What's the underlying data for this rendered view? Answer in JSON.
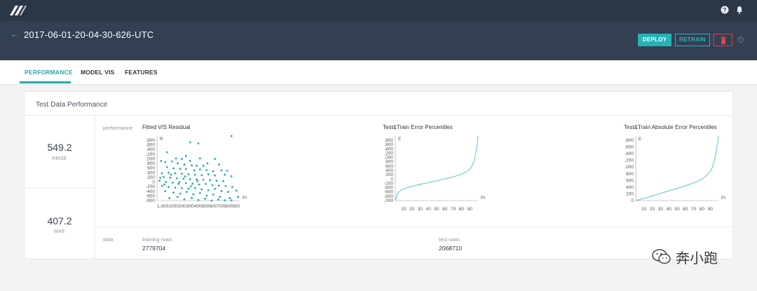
{
  "topbar": {
    "icons": [
      "help-icon",
      "bell-icon"
    ]
  },
  "header": {
    "back_icon": "back-arrow-icon",
    "title": "2017-06-01-20-04-30-626-UTC",
    "buttons": {
      "deploy": "DEPLOY",
      "retrain": "RETRAIN"
    },
    "delete_icon": "trash-icon",
    "settings_icon": "gear-icon"
  },
  "tabs": [
    {
      "label": "PERFORMANCE",
      "active": true
    },
    {
      "label": "MODEL VIS",
      "active": false
    },
    {
      "label": "FEATURES",
      "active": false
    }
  ],
  "card": {
    "title": "Test Data Performance",
    "metrics": [
      {
        "value": "549.2",
        "label": "RMSE"
      },
      {
        "value": "407.2",
        "label": "MAE"
      }
    ],
    "performance_label": "performance",
    "data_label": "data",
    "training_rows_label": "training rows",
    "training_rows_value": "2779704",
    "test_rows_label": "test rows",
    "test_rows_value": "2068710"
  },
  "accent_color": "#2aa6ab",
  "watermark": {
    "text": "奔小跑",
    "icon": "wechat-icon"
  },
  "chart_data": [
    {
      "type": "scatter",
      "title": "Fitted V/S Residual",
      "xlabel": "Pr",
      "ylabel": "R",
      "ytick_labels": [
        ",800",
        ",600",
        ",400",
        ",200",
        ",000",
        "800",
        "600",
        "400",
        "200",
        "0",
        "-200",
        "-400",
        "-600",
        "-800"
      ],
      "xtick_labels": "1,0001000200300400500600700800900",
      "ylim": [
        -800,
        1800
      ],
      "xlim": [
        0,
        1000
      ],
      "points": [
        [
          900,
          1800
        ],
        [
          400,
          1550
        ],
        [
          500,
          1500
        ],
        [
          120,
          1150
        ],
        [
          350,
          1000
        ],
        [
          230,
          900
        ],
        [
          300,
          880
        ],
        [
          400,
          800
        ],
        [
          520,
          900
        ],
        [
          700,
          880
        ],
        [
          50,
          800
        ],
        [
          100,
          750
        ],
        [
          180,
          780
        ],
        [
          250,
          700
        ],
        [
          330,
          650
        ],
        [
          420,
          620
        ],
        [
          480,
          600
        ],
        [
          560,
          600
        ],
        [
          610,
          700
        ],
        [
          750,
          650
        ],
        [
          120,
          550
        ],
        [
          200,
          500
        ],
        [
          280,
          480
        ],
        [
          350,
          470
        ],
        [
          450,
          420
        ],
        [
          520,
          450
        ],
        [
          600,
          430
        ],
        [
          680,
          380
        ],
        [
          780,
          420
        ],
        [
          850,
          400
        ],
        [
          60,
          300
        ],
        [
          140,
          320
        ],
        [
          220,
          300
        ],
        [
          300,
          280
        ],
        [
          380,
          260
        ],
        [
          460,
          240
        ],
        [
          540,
          220
        ],
        [
          620,
          260
        ],
        [
          700,
          210
        ],
        [
          820,
          240
        ],
        [
          900,
          180
        ],
        [
          80,
          150
        ],
        [
          160,
          120
        ],
        [
          240,
          100
        ],
        [
          320,
          80
        ],
        [
          400,
          60
        ],
        [
          480,
          50
        ],
        [
          560,
          40
        ],
        [
          640,
          20
        ],
        [
          720,
          0
        ],
        [
          800,
          -20
        ],
        [
          30,
          0
        ],
        [
          110,
          -50
        ],
        [
          190,
          -80
        ],
        [
          270,
          -60
        ],
        [
          350,
          -100
        ],
        [
          430,
          -120
        ],
        [
          510,
          -150
        ],
        [
          590,
          -130
        ],
        [
          670,
          -180
        ],
        [
          750,
          -200
        ],
        [
          830,
          -220
        ],
        [
          910,
          -250
        ],
        [
          60,
          -200
        ],
        [
          140,
          -250
        ],
        [
          220,
          -280
        ],
        [
          300,
          -300
        ],
        [
          380,
          -320
        ],
        [
          460,
          -300
        ],
        [
          540,
          -350
        ],
        [
          620,
          -380
        ],
        [
          700,
          -330
        ],
        [
          780,
          -420
        ],
        [
          860,
          -450
        ],
        [
          960,
          -400
        ],
        [
          100,
          -420
        ],
        [
          200,
          -480
        ],
        [
          280,
          -520
        ],
        [
          360,
          -450
        ],
        [
          440,
          -550
        ],
        [
          520,
          -500
        ],
        [
          600,
          -600
        ],
        [
          680,
          -560
        ],
        [
          760,
          -650
        ],
        [
          880,
          -700
        ],
        [
          980,
          -650
        ],
        [
          150,
          -700
        ],
        [
          250,
          -650
        ],
        [
          330,
          -750
        ],
        [
          420,
          -700
        ],
        [
          500,
          -780
        ],
        [
          580,
          -720
        ],
        [
          660,
          -800
        ],
        [
          740,
          -760
        ],
        [
          820,
          -790
        ],
        [
          900,
          -790
        ],
        [
          40,
          120
        ],
        [
          90,
          -150
        ],
        [
          170,
          250
        ],
        [
          260,
          -130
        ],
        [
          340,
          170
        ],
        [
          410,
          -220
        ],
        [
          490,
          -20
        ]
      ]
    },
    {
      "type": "line",
      "title": "Test&Train Error Percentiles",
      "xlabel": "Pr",
      "ylabel": "E",
      "ytick_labels": [
        ",800",
        ",600",
        ",400",
        ",200",
        ",000",
        "800",
        "600",
        "400",
        "200",
        "0",
        "-200",
        "-400",
        "-600",
        "-800",
        ",000"
      ],
      "xticks": [
        10,
        20,
        30,
        40,
        50,
        60,
        70,
        80,
        90
      ],
      "xlim": [
        0,
        100
      ],
      "ylim": [
        -1000,
        1800
      ],
      "x": [
        0,
        2,
        5,
        10,
        20,
        30,
        40,
        50,
        60,
        70,
        80,
        85,
        90,
        93,
        95,
        97,
        99,
        100
      ],
      "y": [
        -1000,
        -750,
        -600,
        -500,
        -380,
        -300,
        -220,
        -140,
        -60,
        30,
        140,
        230,
        350,
        520,
        700,
        1000,
        1400,
        1800
      ]
    },
    {
      "type": "line",
      "title": "Test&Train Absolute Error Percentiles",
      "xlabel": "Pr",
      "ylabel": "E",
      "ytick_labels": [
        ",800",
        ",600",
        ",400",
        ",200",
        ",000",
        "800",
        "600",
        "400",
        "200",
        "0"
      ],
      "xticks": [
        10,
        20,
        30,
        40,
        50,
        60,
        70,
        80,
        90
      ],
      "xlim": [
        0,
        100
      ],
      "ylim": [
        0,
        1800
      ],
      "x": [
        0,
        10,
        20,
        30,
        40,
        50,
        60,
        70,
        80,
        85,
        90,
        93,
        95,
        97,
        99,
        100
      ],
      "y": [
        0,
        60,
        130,
        200,
        270,
        340,
        410,
        490,
        600,
        690,
        800,
        950,
        1120,
        1350,
        1600,
        1800
      ]
    }
  ]
}
